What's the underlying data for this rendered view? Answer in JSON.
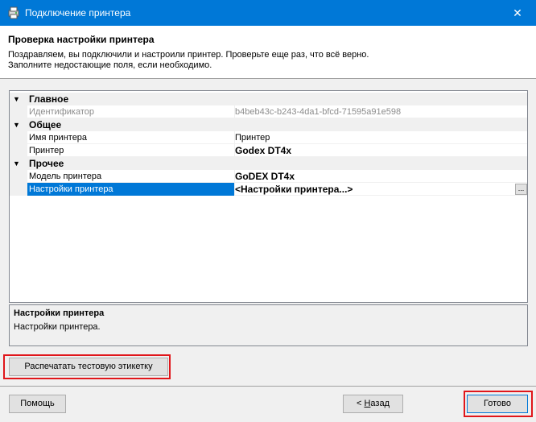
{
  "window": {
    "title": "Подключение принтера",
    "app_icon": "printer-wizard-icon",
    "close_glyph": "✕"
  },
  "header": {
    "title": "Проверка настройки принтера",
    "line1": "Поздравляем, вы подключили и настроили принтер.  Проверьте еще раз, что всё верно.",
    "line2": "Заполните недостающие поля, если необходимо."
  },
  "property_grid": {
    "categories": [
      {
        "label": "Главное",
        "toggle": "▼",
        "props": [
          {
            "name": "Идентификатор",
            "value": "b4beb43c-b243-4da1-bfcd-71595a91e598",
            "readonly": true
          }
        ]
      },
      {
        "label": "Общее",
        "toggle": "▼",
        "props": [
          {
            "name": "Имя принтера",
            "value": "Принтер"
          },
          {
            "name": "Принтер",
            "value": "Godex DT4x",
            "bold": true
          }
        ]
      },
      {
        "label": "Прочее",
        "toggle": "▼",
        "props": [
          {
            "name": "Модель принтера",
            "value": "GoDEX DT4x",
            "bold": true
          },
          {
            "name": "Настройки принтера",
            "value": "<Настройки принтера...>",
            "bold": true,
            "selected": true,
            "button": "..."
          }
        ]
      }
    ]
  },
  "description": {
    "title": "Настройки принтера",
    "text": "Настройки принтера."
  },
  "buttons": {
    "test_label": "Распечатать тестовую этикетку",
    "help_label": "Помощь",
    "back_prefix": "< ",
    "back_mnemonic": "Н",
    "back_rest": "азад",
    "done_label": "Готово"
  },
  "colors": {
    "title_bar": "#0078d7",
    "selection": "#0078d7",
    "highlight_box": "#e0161b"
  }
}
